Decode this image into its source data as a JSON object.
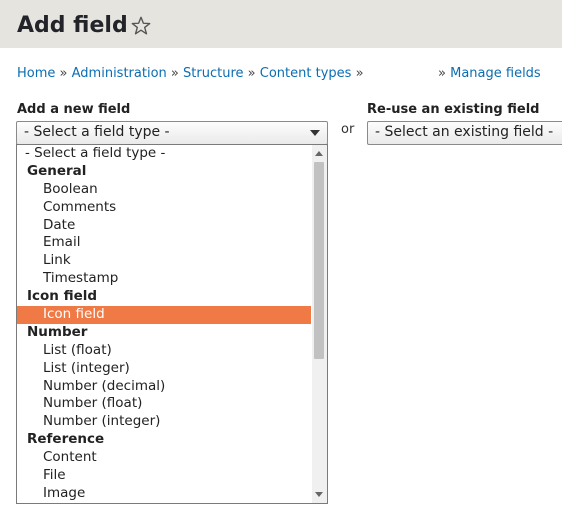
{
  "page": {
    "title": "Add field"
  },
  "breadcrumb": {
    "items": [
      "Home",
      "Administration",
      "Structure",
      "Content types"
    ],
    "separator": "»",
    "manage_fields": "Manage fields"
  },
  "add_field": {
    "label": "Add a new field",
    "selected": "- Select a field type -"
  },
  "or_text": "or",
  "reuse_field": {
    "label": "Re-use an existing field",
    "selected": "- Select an existing field -"
  },
  "dropdown": {
    "options": [
      {
        "text": "- Select a field type -",
        "kind": "placeholder"
      },
      {
        "text": "General",
        "kind": "group"
      },
      {
        "text": "Boolean",
        "kind": "item"
      },
      {
        "text": "Comments",
        "kind": "item"
      },
      {
        "text": "Date",
        "kind": "item"
      },
      {
        "text": "Email",
        "kind": "item"
      },
      {
        "text": "Link",
        "kind": "item"
      },
      {
        "text": "Timestamp",
        "kind": "item"
      },
      {
        "text": "Icon field",
        "kind": "group"
      },
      {
        "text": "Icon field",
        "kind": "item",
        "highlighted": true
      },
      {
        "text": "Number",
        "kind": "group"
      },
      {
        "text": "List (float)",
        "kind": "item"
      },
      {
        "text": "List (integer)",
        "kind": "item"
      },
      {
        "text": "Number (decimal)",
        "kind": "item"
      },
      {
        "text": "Number (float)",
        "kind": "item"
      },
      {
        "text": "Number (integer)",
        "kind": "item"
      },
      {
        "text": "Reference",
        "kind": "group"
      },
      {
        "text": "Content",
        "kind": "item"
      },
      {
        "text": "File",
        "kind": "item"
      },
      {
        "text": "Image",
        "kind": "item"
      }
    ],
    "highlight_color": "#f07a45"
  },
  "colors": {
    "header_bg": "#e6e4df",
    "link": "#0b6eb2"
  },
  "icons": {
    "shortcut": "star-outline-icon"
  }
}
